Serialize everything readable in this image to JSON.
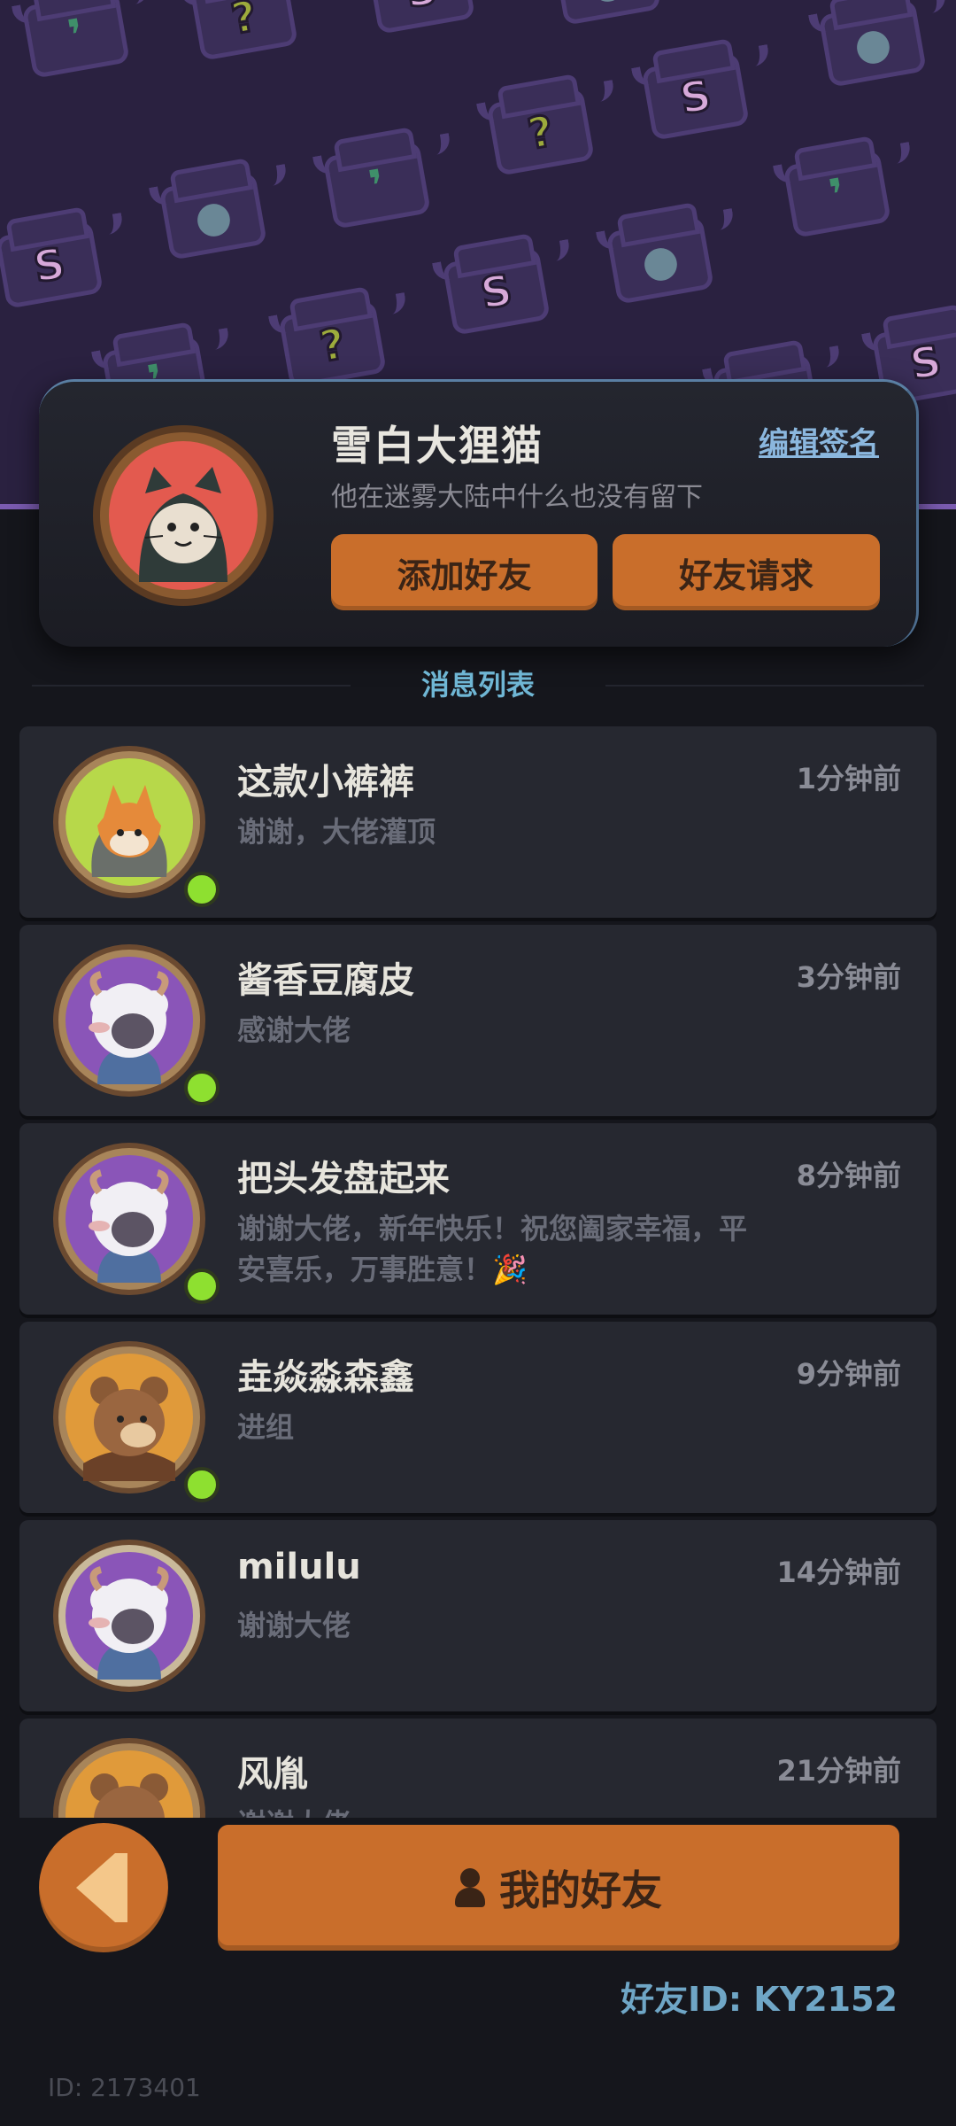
{
  "profile": {
    "name": "雪白大狸猫",
    "edit_sign_label": "编辑签名",
    "signature": "他在迷雾大陆中什么也没有留下",
    "add_friend_label": "添加好友",
    "friend_request_label": "好友请求"
  },
  "section_title": "消息列表",
  "messages": [
    {
      "name": "这款小裤裤",
      "time": "1分钟前",
      "text": "谢谢，大佬灌顶",
      "online": true,
      "avatar": "fox-avatar"
    },
    {
      "name": "酱香豆腐皮",
      "time": "3分钟前",
      "text": "感谢大佬",
      "online": true,
      "avatar": "sheep-avatar"
    },
    {
      "name": "把头发盘起来",
      "time": "8分钟前",
      "text": "谢谢大佬，新年快乐！祝您阖家幸福，平安喜乐，万事胜意！🎉",
      "online": true,
      "avatar": "sheep-avatar"
    },
    {
      "name": "垚焱淼森鑫",
      "time": "9分钟前",
      "text": "进组",
      "online": true,
      "avatar": "bear-avatar"
    },
    {
      "name": "milulu",
      "time": "14分钟前",
      "text": "谢谢大佬",
      "online": false,
      "avatar": "sheep-avatar"
    },
    {
      "name": "风胤",
      "time": "21分钟前",
      "text": "谢谢大佬",
      "online": false,
      "avatar": "bear-avatar"
    }
  ],
  "bottom": {
    "my_friends_label": "我的好友",
    "friend_id": "好友ID: KY2152",
    "user_id": "ID: 2173401"
  },
  "colors": {
    "accent_orange": "#c96e2b",
    "online_green": "#8ee030",
    "link_blue": "#8bb7de",
    "banner_purple": "#2a2140"
  }
}
